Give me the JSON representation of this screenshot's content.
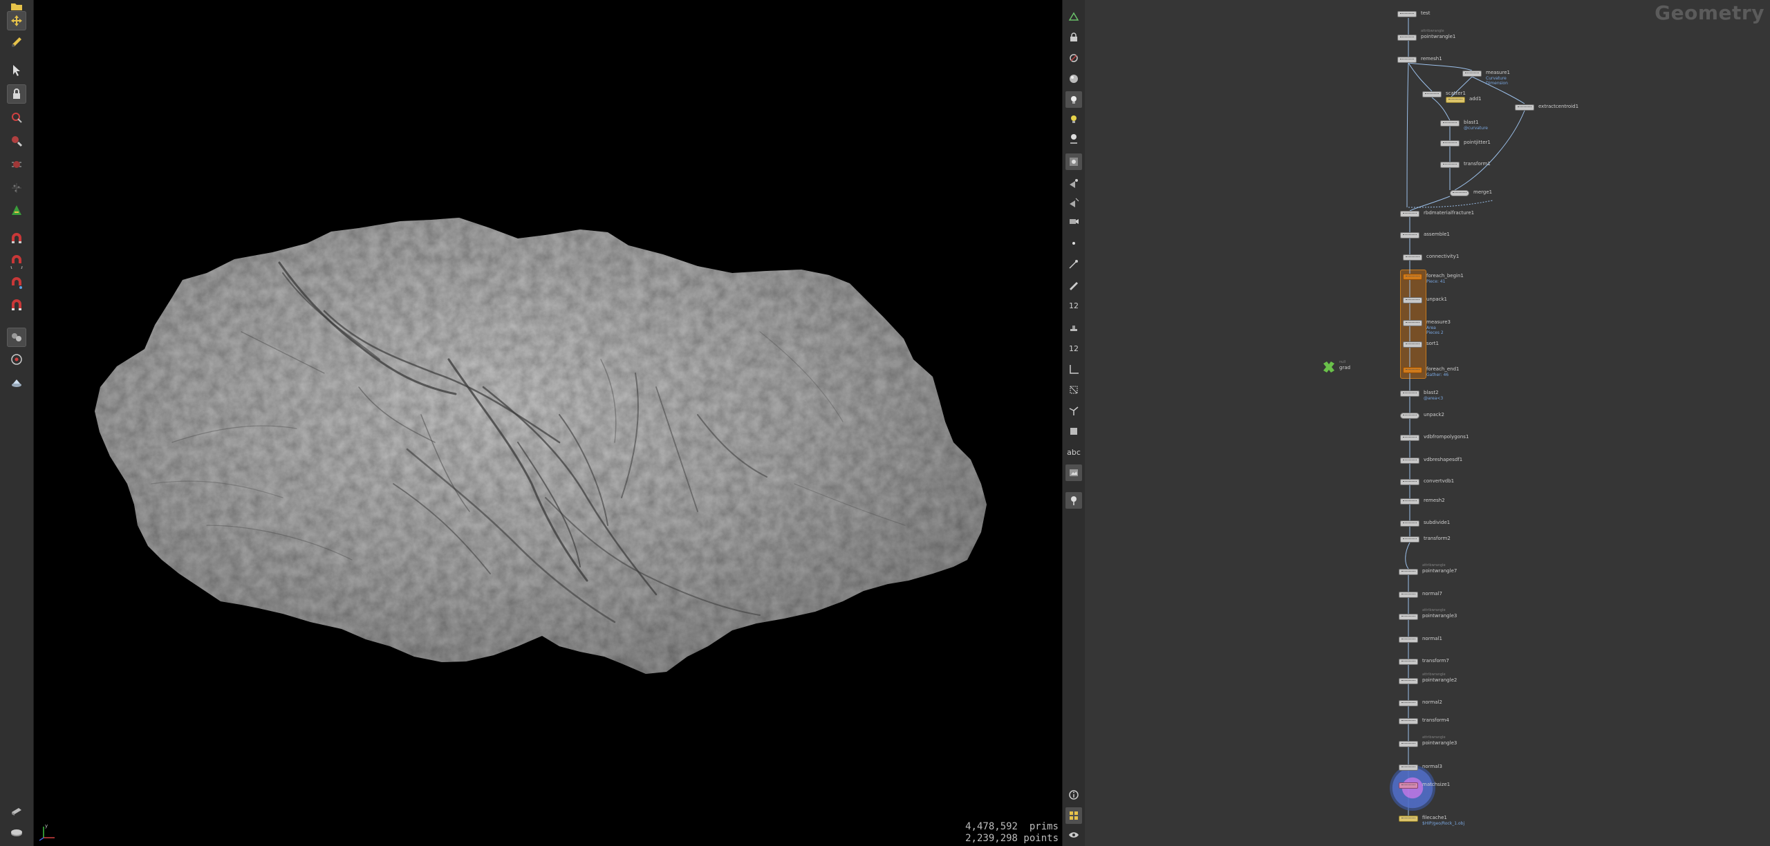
{
  "left_shelf": {
    "tools": [
      {
        "icon": "folder-icon",
        "active": false
      },
      {
        "icon": "move-transform-icon",
        "active": true
      },
      {
        "icon": "paint-icon",
        "active": false
      },
      {
        "icon": "select-arrow-icon",
        "active": false
      },
      {
        "icon": "lock-icon",
        "active": true
      },
      {
        "icon": "magnet-select-icon",
        "active": false
      },
      {
        "icon": "magnifier-icon",
        "active": false
      },
      {
        "icon": "bug-icon",
        "active": false
      },
      {
        "icon": "particles-icon",
        "active": false
      },
      {
        "icon": "pose-icon",
        "active": false
      },
      {
        "icon": "magnet-lock-icon",
        "active": false
      },
      {
        "icon": "magnet-rotate-icon",
        "active": false
      },
      {
        "icon": "magnet-snap-icon",
        "active": false
      },
      {
        "icon": "magnet-icon",
        "active": false
      },
      {
        "icon": "group-icon",
        "active": true
      },
      {
        "icon": "camera-orbit-icon",
        "active": false
      },
      {
        "icon": "layers-icon",
        "active": false
      },
      {
        "icon": "render-icon",
        "active": false
      },
      {
        "icon": "disk-icon",
        "active": false
      }
    ]
  },
  "viewport": {
    "stats": {
      "prims_value": "4,478,592",
      "prims_label": "prims",
      "points_value": "2,239,298",
      "points_label": "points"
    },
    "colors": {
      "background": "#000000",
      "rock": "#a8a8a8"
    }
  },
  "view_toolbar": {
    "tools": [
      {
        "icon": "pin-display-icon"
      },
      {
        "icon": "lock-camera-icon"
      },
      {
        "icon": "no-select-icon"
      },
      {
        "icon": "shading-sphere-icon"
      },
      {
        "icon": "light-icon"
      },
      {
        "icon": "light-bulb-icon"
      },
      {
        "icon": "headlight-icon"
      },
      {
        "icon": "background-image-icon"
      },
      {
        "icon": "camera-view-icon"
      },
      {
        "icon": "camera-link-icon"
      },
      {
        "icon": "camera-icon"
      },
      {
        "icon": "point-icon"
      },
      {
        "icon": "brush-icon"
      },
      {
        "icon": "pen-icon"
      },
      {
        "icon": "number-icon",
        "text": "12"
      },
      {
        "icon": "stamp-icon"
      },
      {
        "icon": "number-icon-2",
        "text": "12"
      },
      {
        "icon": "ruler-icon"
      },
      {
        "icon": "bounding-box-icon"
      },
      {
        "icon": "gizmo-icon"
      },
      {
        "icon": "frame-icon"
      },
      {
        "icon": "text-icon",
        "text": "abc"
      },
      {
        "icon": "display-options-icon"
      },
      {
        "icon": "pin-icon"
      },
      {
        "icon": "info-icon"
      },
      {
        "icon": "grid-icon"
      },
      {
        "icon": "eye-icon"
      }
    ]
  },
  "network": {
    "title": "Geometry",
    "foreach_color": "#c77a1e",
    "nodes": [
      {
        "label": "test",
        "style": ""
      },
      {
        "label": "pointwrangle1",
        "pre": "attribwrangle",
        "style": ""
      },
      {
        "label": "remesh1",
        "style": ""
      },
      {
        "label": "measure1",
        "sub": "Curvature",
        "sub2": "Dimension",
        "style": ""
      },
      {
        "label": "scatter1",
        "style": ""
      },
      {
        "label": "add1",
        "style": "yellow"
      },
      {
        "label": "extractcentroid1",
        "style": ""
      },
      {
        "label": "blast1",
        "sub": "@curvature",
        "style": ""
      },
      {
        "label": "pointjitter1",
        "style": ""
      },
      {
        "label": "transform1",
        "style": ""
      },
      {
        "label": "merge1",
        "style": "round"
      },
      {
        "label": "rbdmaterialfracture1",
        "style": ""
      },
      {
        "label": "assemble1",
        "style": ""
      },
      {
        "label": "connectivity1",
        "style": ""
      },
      {
        "label": "foreach_begin1",
        "sub": "Piece: 41",
        "style": "orange"
      },
      {
        "label": "unpack1",
        "style": ""
      },
      {
        "label": "measure3",
        "sub": "Area",
        "sub2": "Pieces 2",
        "style": ""
      },
      {
        "label": "sort1",
        "style": ""
      },
      {
        "label": "foreach_end1",
        "sub": "Gather: 46",
        "style": "orange"
      },
      {
        "label": "blast2",
        "sub": "@area<3",
        "style": ""
      },
      {
        "label": "unpack2",
        "style": "round"
      },
      {
        "label": "vdbfrompolygons1",
        "style": ""
      },
      {
        "label": "vdbreshapesdf1",
        "style": ""
      },
      {
        "label": "convertvdb1",
        "style": ""
      },
      {
        "label": "remesh2",
        "style": ""
      },
      {
        "label": "subdivide1",
        "style": ""
      },
      {
        "label": "transform2",
        "style": ""
      },
      {
        "label": "pointwrangle7",
        "pre": "attribwrangle",
        "style": ""
      },
      {
        "label": "normal7",
        "style": ""
      },
      {
        "label": "pointwrangle3",
        "pre": "attribwrangle",
        "style": ""
      },
      {
        "label": "normal1",
        "style": ""
      },
      {
        "label": "transform7",
        "style": ""
      },
      {
        "label": "pointwrangle2",
        "pre": "attribwrangle",
        "style": ""
      },
      {
        "label": "normal2",
        "style": ""
      },
      {
        "label": "transform4",
        "style": ""
      },
      {
        "label": "pointwrangle3",
        "pre": "attribwrangle",
        "style": ""
      },
      {
        "label": "normal3",
        "style": ""
      },
      {
        "label": "matchsize1",
        "style": "pink"
      },
      {
        "label": "filecache1",
        "sub": "$HIP/geo/Rock_1.obj",
        "style": "yellow"
      }
    ],
    "null_node": {
      "label": "grad",
      "pre": "null"
    }
  }
}
